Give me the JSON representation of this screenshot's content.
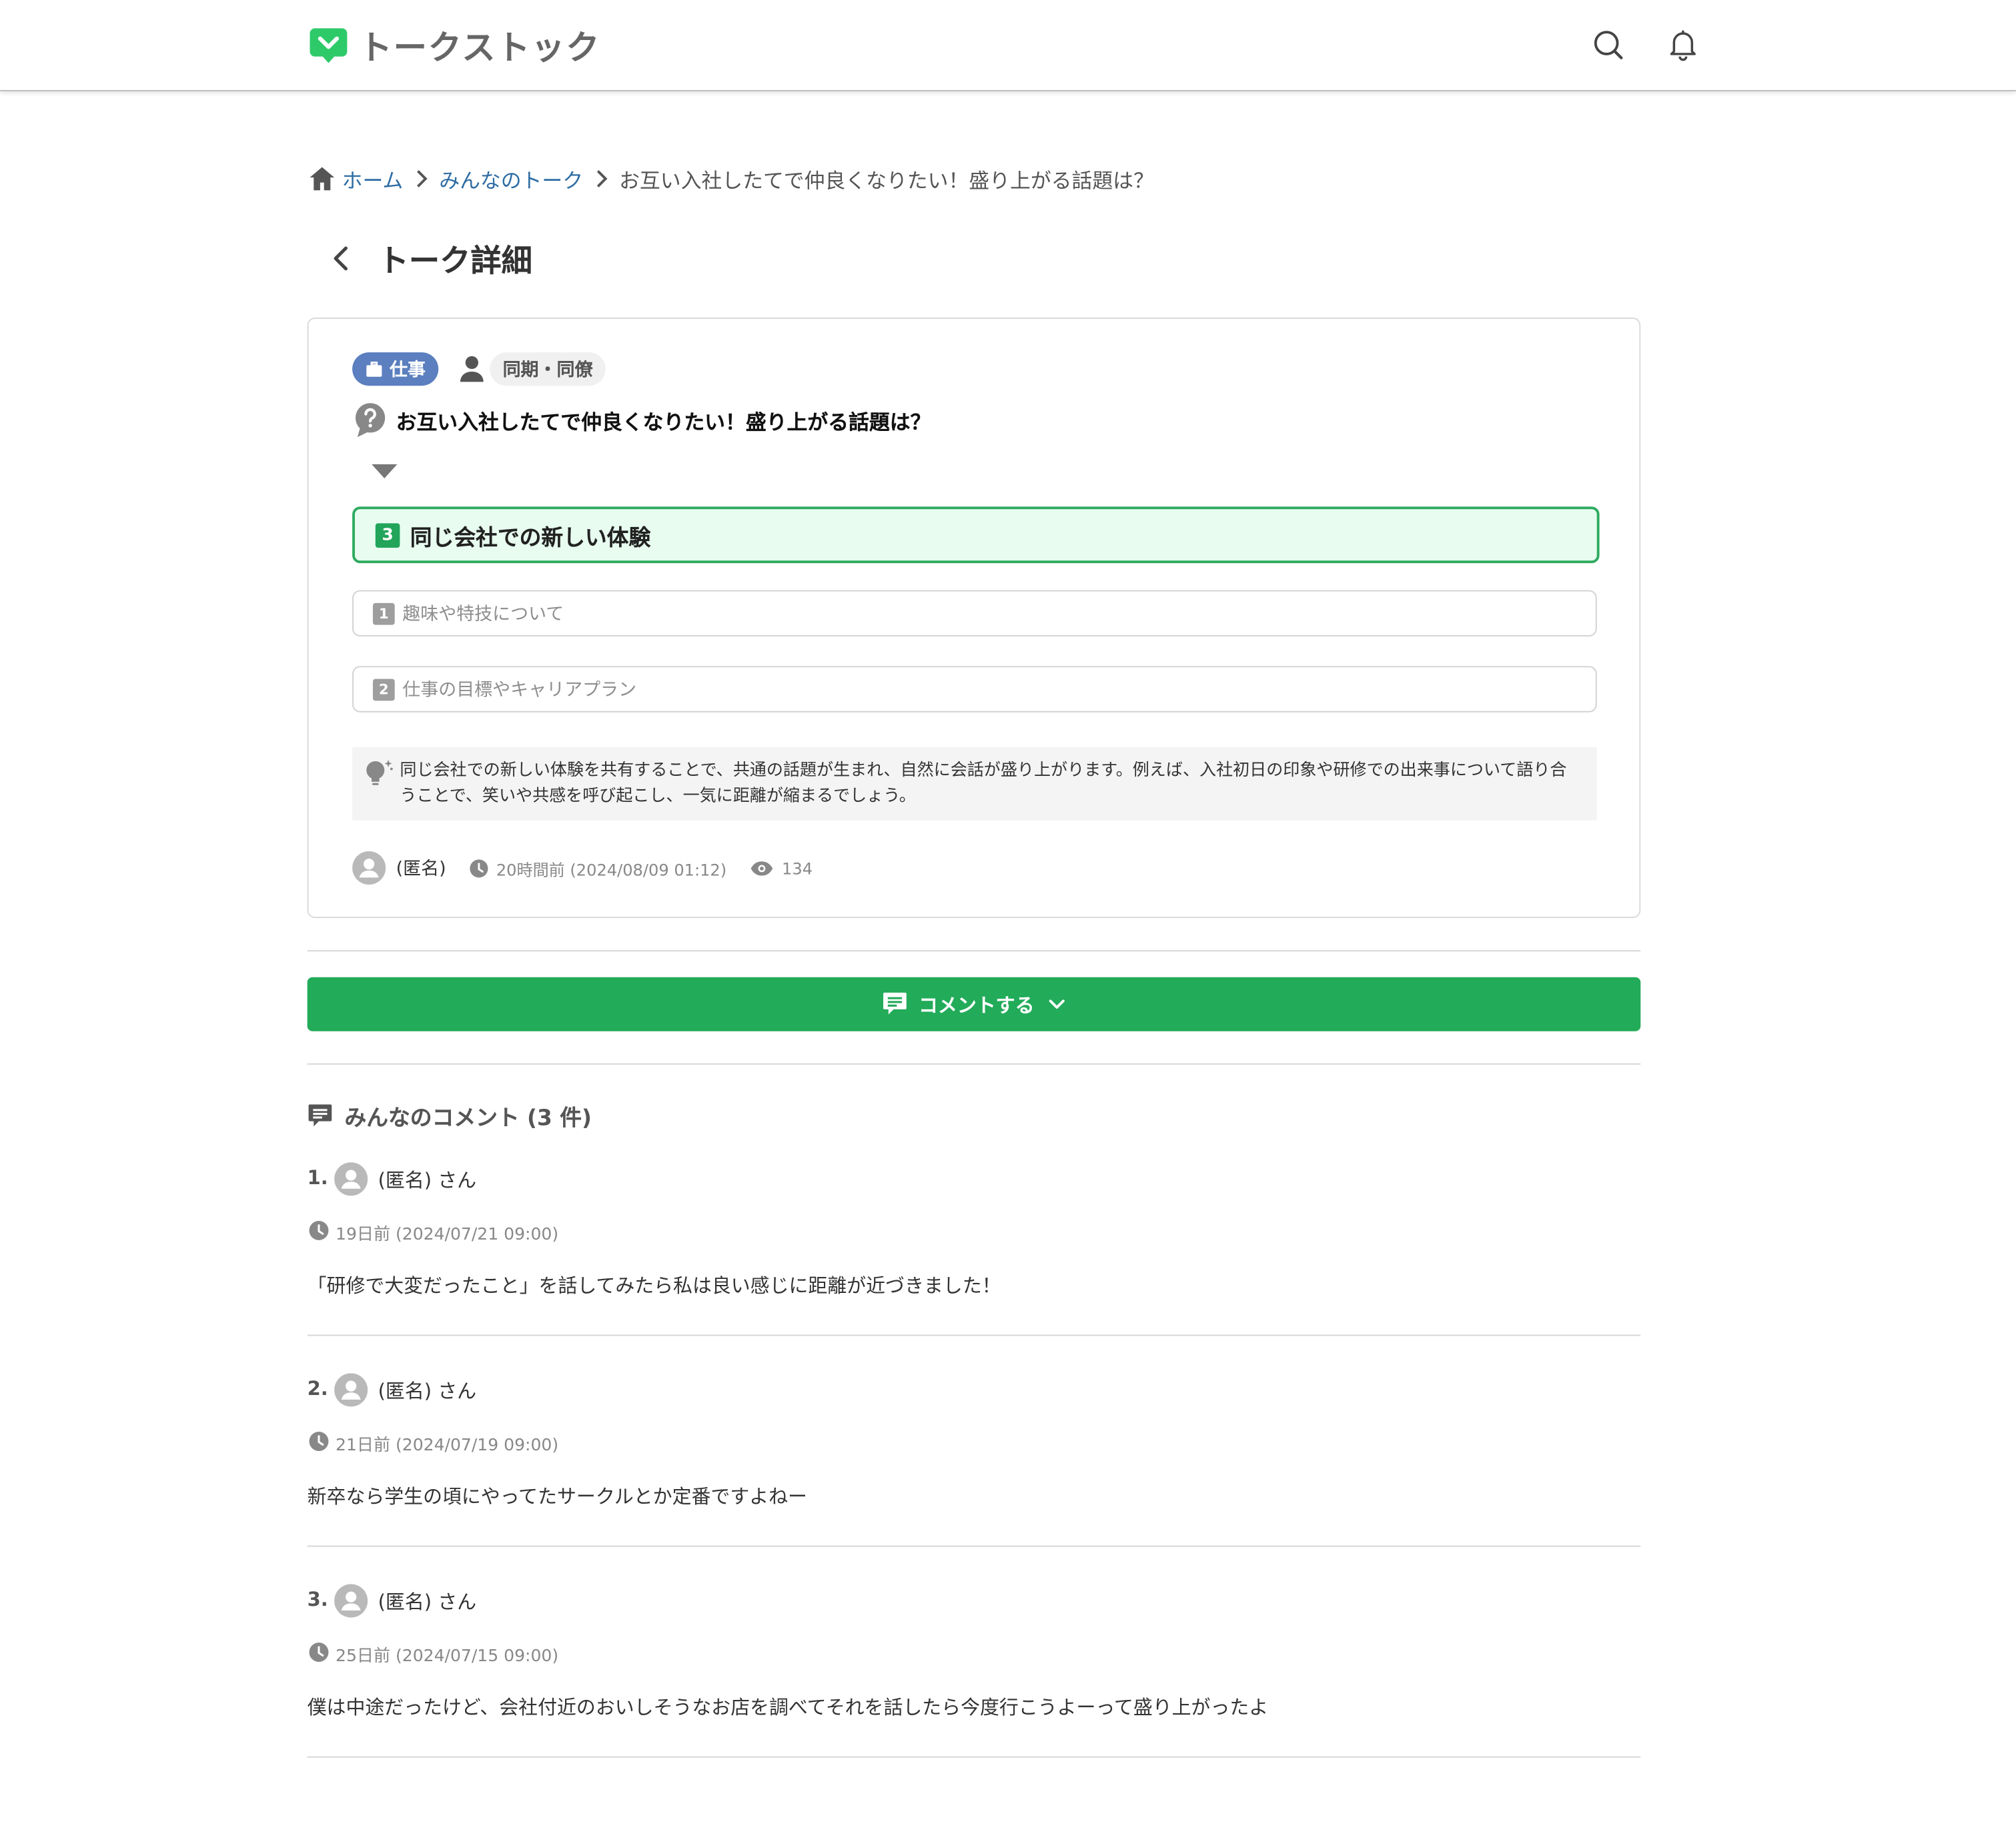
{
  "app": {
    "name": "トークストック",
    "brand_color": "#2eca6a"
  },
  "header": {
    "icons": [
      "search-icon",
      "bell-icon"
    ]
  },
  "breadcrumb": {
    "home": "ホーム",
    "category": "みんなのトーク",
    "current": "お互い入社したてで仲良くなりたい！盛り上がる話題は？"
  },
  "page": {
    "title": "トーク詳細"
  },
  "talk": {
    "category_tag": "仕事",
    "relation_tag": "同期・同僚",
    "question": "お互い入社したてで仲良くなりたい！盛り上がる話題は？",
    "options": [
      {
        "rank": "3",
        "label": "同じ会社での新しい体験",
        "selected": true
      },
      {
        "rank": "1",
        "label": "趣味や特技について",
        "selected": false
      },
      {
        "rank": "2",
        "label": "仕事の目標やキャリアプラン",
        "selected": false
      }
    ],
    "hint": "同じ会社での新しい体験を共有することで、共通の話題が生まれ、自然に会話が盛り上がります。例えば、入社初日の印象や研修での出来事について語り合うことで、笑いや共感を呼び起こし、一気に距離が縮まるでしょう。",
    "author": "(匿名)",
    "posted": "20時間前 (2024/08/09 01:12)",
    "views": "134"
  },
  "comment_button": {
    "label": "コメントする"
  },
  "comments_section": {
    "heading": "みんなのコメント (3 件)",
    "items": [
      {
        "no": "1.",
        "author": "(匿名) さん",
        "time": "19日前 (2024/07/21 09:00)",
        "body": "「研修で大変だったこと」を話してみたら私は良い感じに距離が近づきました！"
      },
      {
        "no": "2.",
        "author": "(匿名) さん",
        "time": "21日前 (2024/07/19 09:00)",
        "body": "新卒なら学生の頃にやってたサークルとか定番ですよねー"
      },
      {
        "no": "3.",
        "author": "(匿名) さん",
        "time": "25日前 (2024/07/15 09:00)",
        "body": "僕は中途だったけど、会社付近のおいしそうなお店を調べてそれを話したら今度行こうよーって盛り上がったよ"
      }
    ]
  }
}
